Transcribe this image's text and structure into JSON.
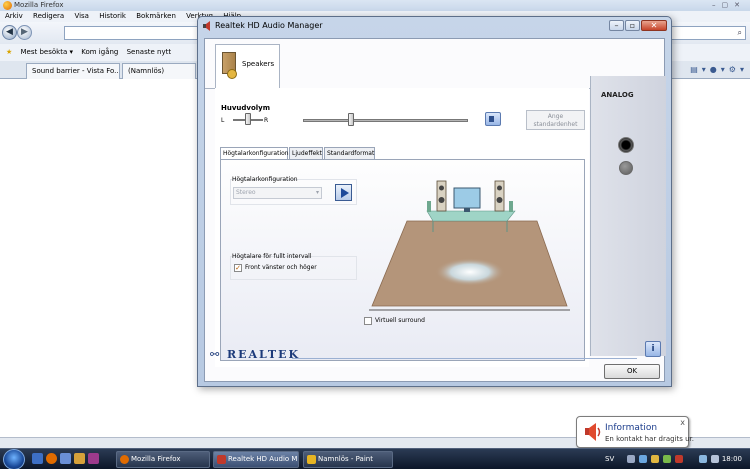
{
  "firefox": {
    "title": "Mozilla Firefox",
    "menu": [
      "Arkiv",
      "Redigera",
      "Visa",
      "Historik",
      "Bokmärken",
      "Verktyg",
      "Hjälp"
    ],
    "bookmarks": [
      "Mest besökta ▾",
      "Kom igång",
      "Senaste nytt"
    ],
    "tabs": [
      "Sound barrier - Vista Fo...",
      "(Namnlös)"
    ]
  },
  "realtek": {
    "title": "Realtek HD Audio Manager",
    "speakers_tab": "Speakers",
    "volume_label": "Huvudvolym",
    "left_label": "L",
    "right_label": "R",
    "set_default_button": "Ange standardenhet",
    "subtabs": [
      "Högtalarkonfiguration",
      "Ljudeffekt",
      "Standardformat"
    ],
    "speaker_config_label": "Högtalarkonfiguration",
    "speaker_config_value": "Stereo",
    "fullrange_label": "Högtalare för fullt intervall",
    "front_lr_label": "Front vänster och höger",
    "front_lr_checked": true,
    "virtual_surround_label": "Virtuell surround",
    "virtual_surround_checked": false,
    "analog_label": "ANALOG",
    "brand": "REALTEK",
    "ok_button": "OK",
    "volume_level": 0.29,
    "balance_level": 0.5
  },
  "balloon": {
    "title": "Information",
    "text": "En kontakt har dragits ur.",
    "close": "x"
  },
  "taskbar": {
    "buttons": [
      "Mozilla Firefox",
      "Realtek HD Audio M...",
      "Namnlös - Paint"
    ],
    "language": "SV",
    "clock": "18:00"
  },
  "colors": {
    "accent": "#1c3a7a",
    "floor": "#b4957a",
    "window_frame": "#c6d5e9"
  }
}
